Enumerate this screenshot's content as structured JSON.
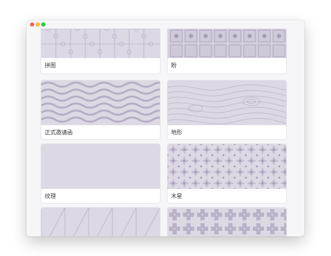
{
  "window": {
    "controls": [
      "close",
      "minimize",
      "maximize"
    ]
  },
  "patterns": {
    "items": [
      {
        "label": "拼图",
        "pattern": "puzzle"
      },
      {
        "label": "盼",
        "pattern": "cubes"
      },
      {
        "label": "正式邀请函",
        "pattern": "waves"
      },
      {
        "label": "地形",
        "pattern": "topography"
      },
      {
        "label": "纹理",
        "pattern": "plain"
      },
      {
        "label": "木星",
        "pattern": "cross-grid"
      },
      {
        "label": "",
        "pattern": "diagonal-lines"
      },
      {
        "label": "",
        "pattern": "plus-tiles"
      }
    ]
  },
  "colors": {
    "swatch_background": "#dcd8e4",
    "pattern_stroke": "#b9b2c8",
    "pattern_dark": "#a59cb6",
    "card_background": "#ffffff",
    "window_background": "#f6f6f8"
  }
}
